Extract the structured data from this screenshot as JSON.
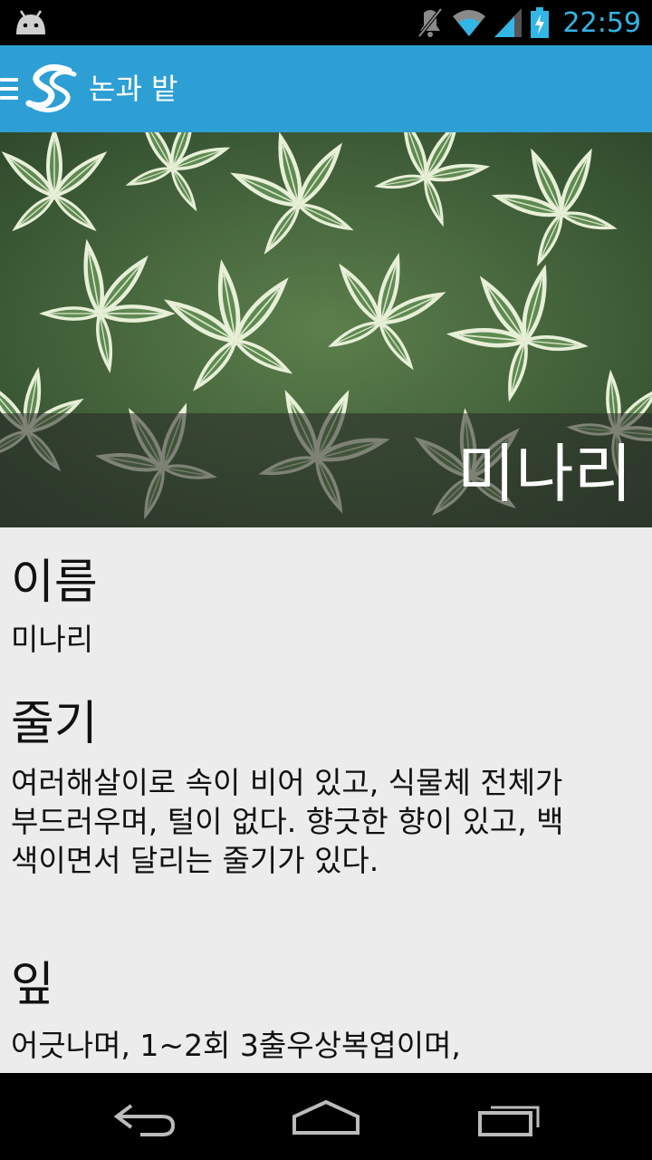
{
  "status_bar": {
    "time": "22:59",
    "icons": [
      "android-icon",
      "mute-icon",
      "wifi-icon",
      "signal-icon",
      "battery-charging-icon"
    ],
    "accent_color": "#33b5e5"
  },
  "action_bar": {
    "title": "논과 밭",
    "background_color": "#2d9fd4"
  },
  "hero": {
    "title": "미나리"
  },
  "sections": [
    {
      "heading": "이름",
      "body": "미나리"
    },
    {
      "heading": "줄기",
      "body": "여러해살이로 속이 비어 있고, 식물체 전체가 부드러우며, 털이 없다. 향긋한 향이 있고, 백색이면서 달리는 줄기가 있다."
    },
    {
      "heading": "잎",
      "body": "어긋나며, 1~2회 3출우상복엽이며,"
    }
  ],
  "nav_bar": {
    "buttons": [
      "back-icon",
      "home-icon",
      "recent-apps-icon"
    ]
  }
}
